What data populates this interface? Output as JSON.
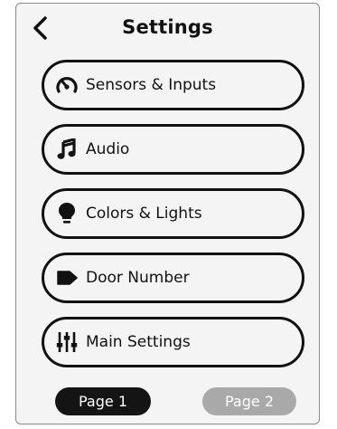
{
  "header": {
    "title": "Settings",
    "back_icon": "chevron-left-icon"
  },
  "menu": [
    {
      "label": "Sensors & Inputs",
      "icon": "gauge-icon"
    },
    {
      "label": "Audio",
      "icon": "music-note-icon"
    },
    {
      "label": "Colors & Lights",
      "icon": "lightbulb-icon"
    },
    {
      "label": "Door Number",
      "icon": "tag-icon"
    },
    {
      "label": "Main Settings",
      "icon": "sliders-icon"
    }
  ],
  "pagination": {
    "page1_label": "Page 1",
    "page2_label": "Page 2",
    "active_page": 1
  },
  "colors": {
    "background": "#f4f4f4",
    "foreground": "#111111",
    "active_page": "#141414",
    "inactive_page": "#a9a9a9"
  }
}
